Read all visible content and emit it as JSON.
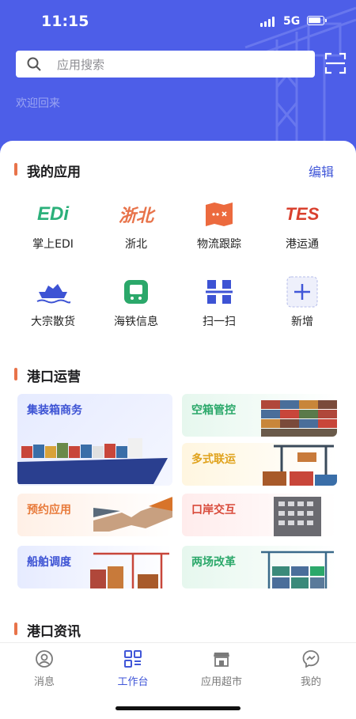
{
  "status": {
    "time": "11:15",
    "network": "5G"
  },
  "search": {
    "placeholder": "应用搜索"
  },
  "welcome": "欢迎回来",
  "my_apps": {
    "title": "我的应用",
    "edit": "编辑",
    "items": [
      {
        "label": "掌上EDI",
        "logo": "EDi",
        "icon": "edi-logo"
      },
      {
        "label": "浙北",
        "logo": "浙北",
        "icon": "zhebei-logo"
      },
      {
        "label": "物流跟踪",
        "icon": "map-icon"
      },
      {
        "label": "港运通",
        "logo": "TES",
        "icon": "tes-logo"
      },
      {
        "label": "大宗散货",
        "icon": "ship-icon"
      },
      {
        "label": "海铁信息",
        "icon": "train-icon"
      },
      {
        "label": "扫一扫",
        "icon": "scan-icon"
      },
      {
        "label": "新增",
        "icon": "plus-icon"
      }
    ]
  },
  "port_ops": {
    "title": "港口运营",
    "tiles": [
      {
        "label": "集装箱商务",
        "color": "#3d53d4"
      },
      {
        "label": "空箱管控",
        "color": "#2ba86a"
      },
      {
        "label": "多式联运",
        "color": "#e0a21c"
      },
      {
        "label": "预约应用",
        "color": "#e87a3a"
      },
      {
        "label": "口岸交互",
        "color": "#d94a3a"
      },
      {
        "label": "船舶调度",
        "color": "#3d53d4"
      },
      {
        "label": "两场改革",
        "color": "#2ba86a"
      }
    ]
  },
  "port_news": {
    "title": "港口资讯"
  },
  "tabs": [
    {
      "label": "消息",
      "icon": "user-circle-icon"
    },
    {
      "label": "工作台",
      "icon": "grid-icon",
      "active": true
    },
    {
      "label": "应用超市",
      "icon": "store-icon"
    },
    {
      "label": "我的",
      "icon": "messenger-icon"
    }
  ],
  "colors": {
    "brand": "#4d5ee8",
    "accent": "#4157d8",
    "section_bar": "#e8734a"
  }
}
